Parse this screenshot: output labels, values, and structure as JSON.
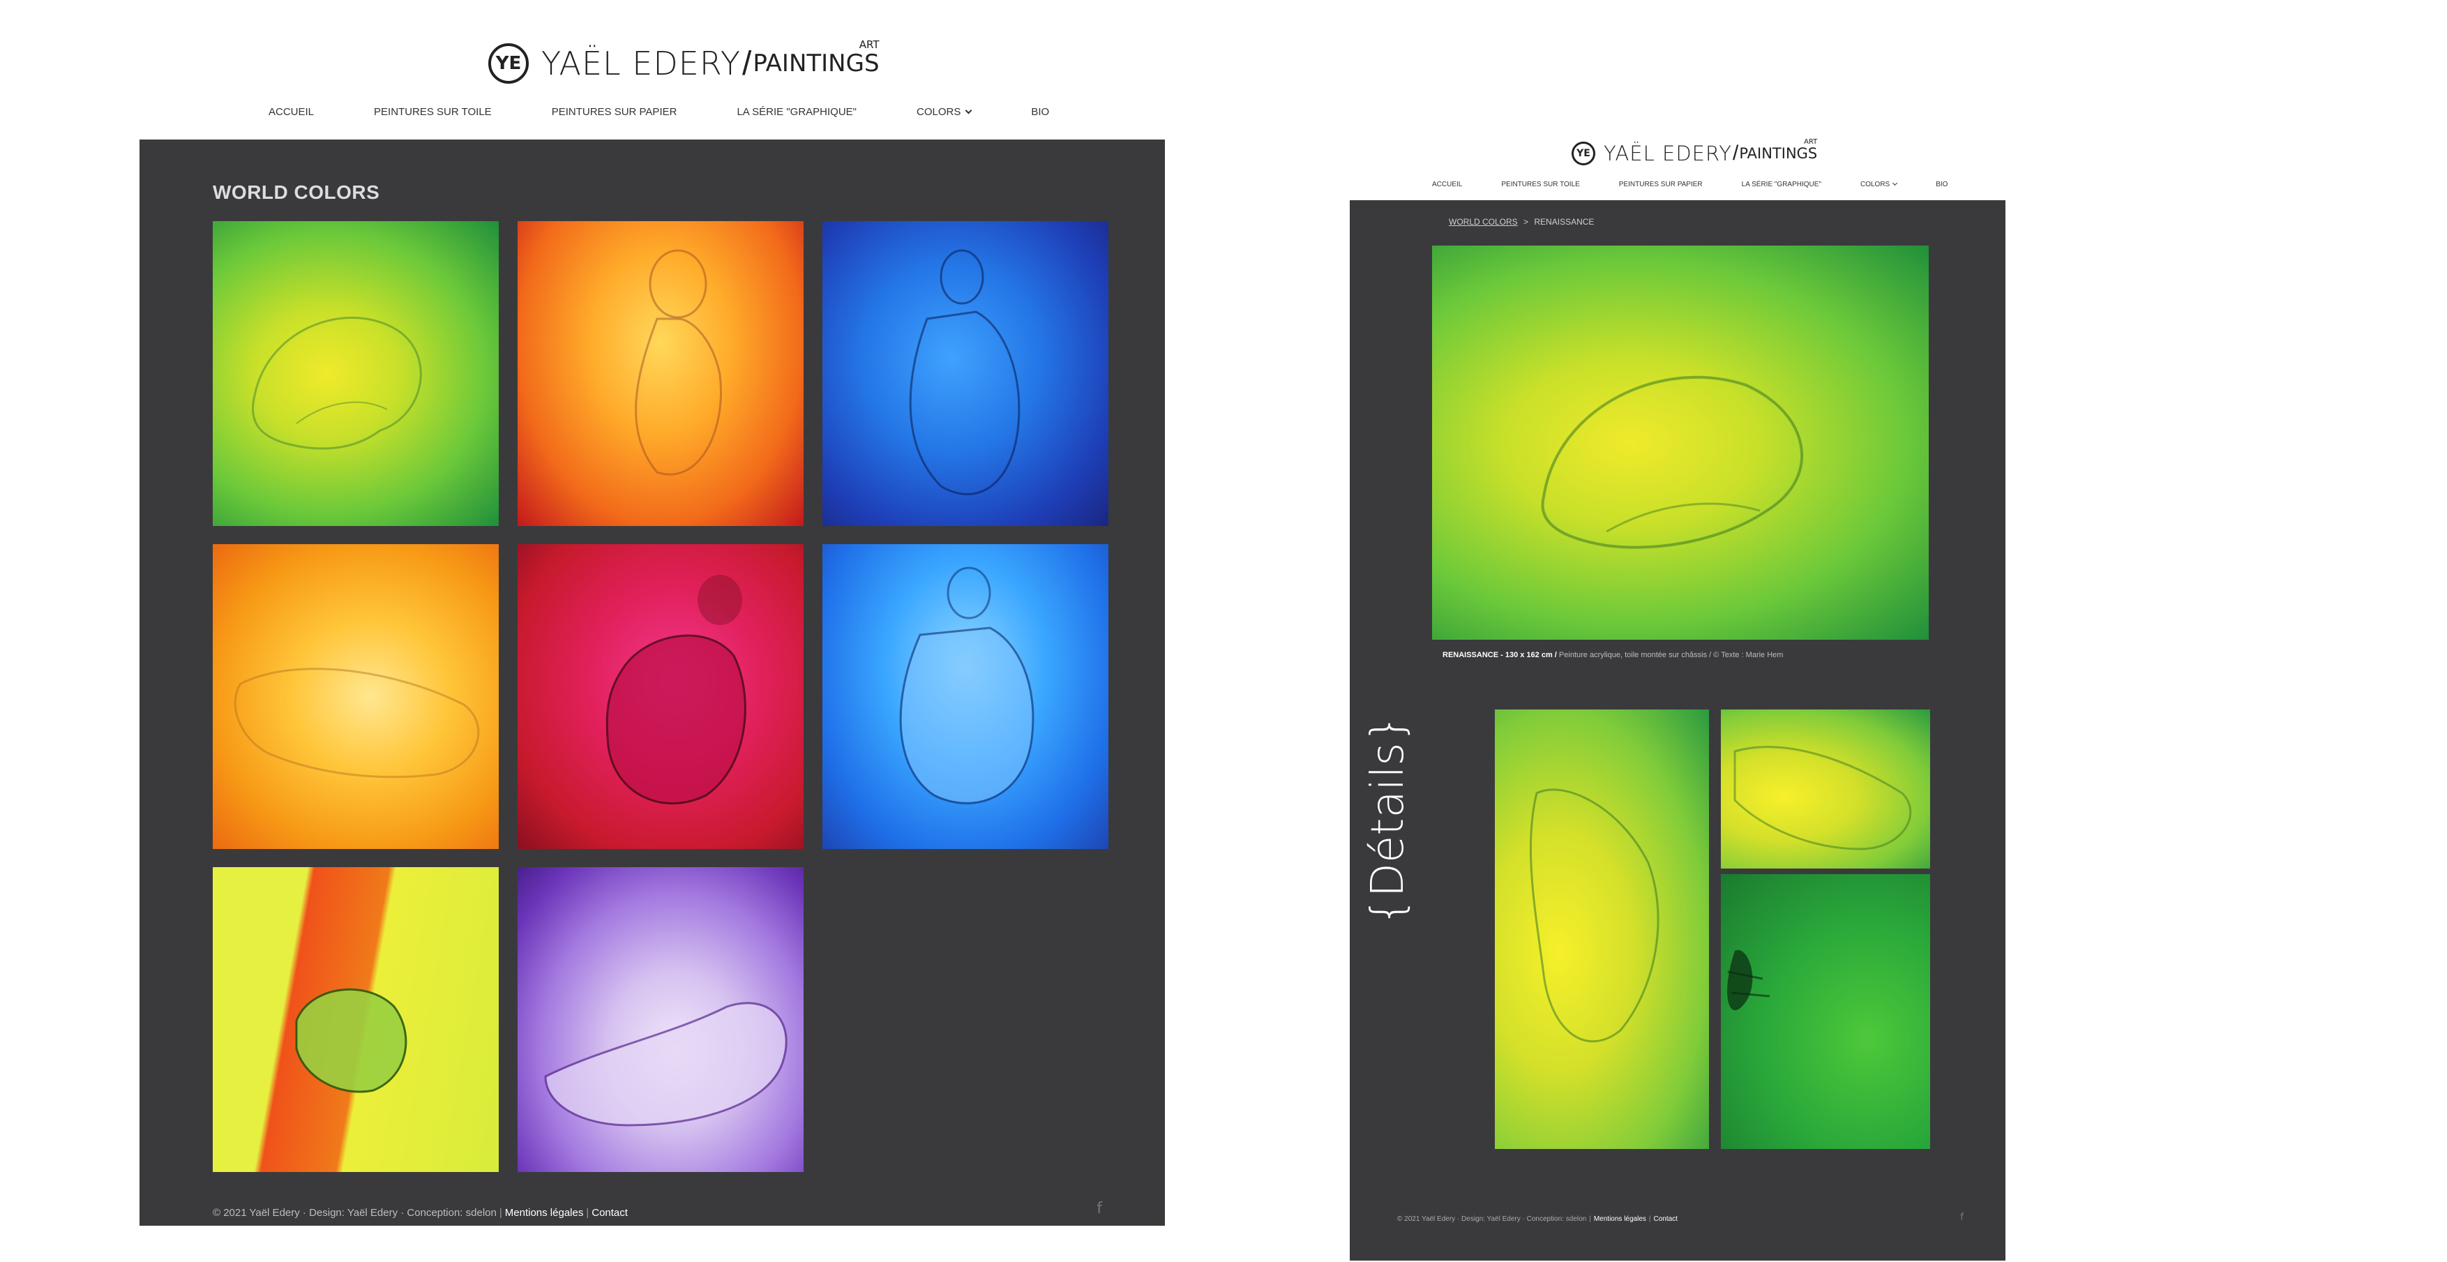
{
  "site": {
    "logo_mark": "YE",
    "logo_name": "YAËL EDERY",
    "logo_separator": "/",
    "logo_sub": "PAINTINGS",
    "logo_art": "ART"
  },
  "nav": {
    "items": [
      {
        "label": "ACCUEIL"
      },
      {
        "label": "PEINTURES SUR TOILE"
      },
      {
        "label": "PEINTURES SUR PAPIER"
      },
      {
        "label": "LA SÉRIE \"GRAPHIQUE\""
      },
      {
        "label": "COLORS",
        "has_dropdown": true
      },
      {
        "label": "BIO"
      }
    ]
  },
  "gallery": {
    "title": "WORLD COLORS",
    "paintings": [
      {
        "palette": "green"
      },
      {
        "palette": "orange"
      },
      {
        "palette": "blue"
      },
      {
        "palette": "yellow"
      },
      {
        "palette": "red"
      },
      {
        "palette": "cyan"
      },
      {
        "palette": "stripe"
      },
      {
        "palette": "purple"
      }
    ]
  },
  "detail_page": {
    "breadcrumb": {
      "parent": "WORLD COLORS",
      "separator": ">",
      "current": "RENAISSANCE"
    },
    "caption": {
      "title": "RENAISSANCE - 130 x 162 cm /",
      "description": "Peinture acrylique, toile montée sur châssis / © Texte : Marie Hem"
    },
    "details_label": "{Détails}"
  },
  "footer": {
    "copyright": "© 2021 Yaël Edery · Design: Yaël Edery · Conception: sdelon",
    "legal": "Mentions légales",
    "separator": "|",
    "contact": "Contact",
    "social_icon": "f"
  },
  "colors": {
    "panel_bg": "#3a3a3c",
    "page_bg": "#ffffff",
    "nav_text": "#333333",
    "panel_text": "#dddddd"
  },
  "icons": [
    "logo-monogram-icon",
    "chevron-down-icon",
    "facebook-icon"
  ]
}
